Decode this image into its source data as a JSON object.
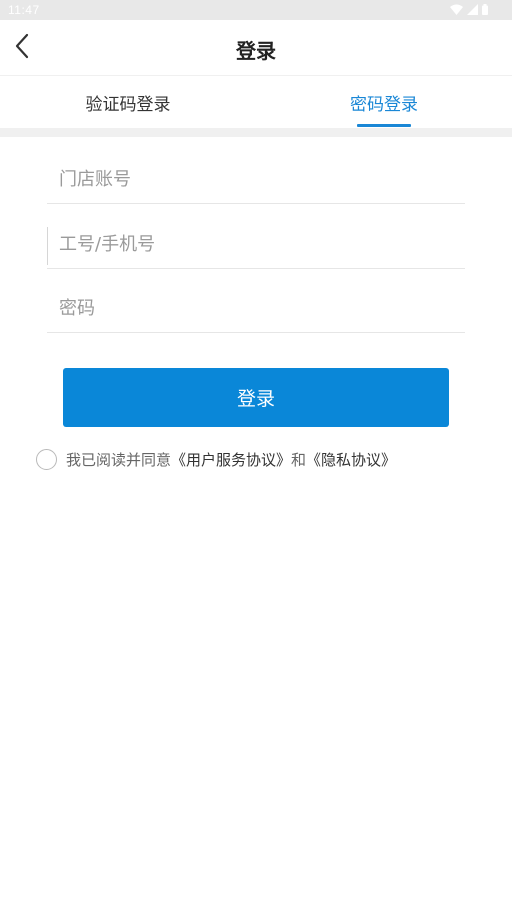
{
  "status_bar": {
    "time": "11:47",
    "icons": [
      "wifi-icon",
      "signal-icon",
      "battery-icon"
    ]
  },
  "nav": {
    "title": "登录",
    "back_icon": "chevron-left-icon"
  },
  "tabs": [
    {
      "label": "验证码登录",
      "active": false
    },
    {
      "label": "密码登录",
      "active": true
    }
  ],
  "form": {
    "store_account": {
      "value": "",
      "placeholder": "门店账号"
    },
    "employee_phone": {
      "value": "",
      "placeholder": "工号/手机号"
    },
    "password": {
      "value": "",
      "placeholder": "密码"
    }
  },
  "login_button": {
    "label": "登录"
  },
  "agreement": {
    "prefix": "我已阅读并同意",
    "user_service_link": "《用户服务协议》",
    "conjunction": "和",
    "privacy_link": "《隐私协议》",
    "checked": false
  },
  "colors": {
    "accent": "#0a87d8",
    "tab_active": "#1a87d6",
    "status_bar_bg": "#e8e8e8"
  }
}
